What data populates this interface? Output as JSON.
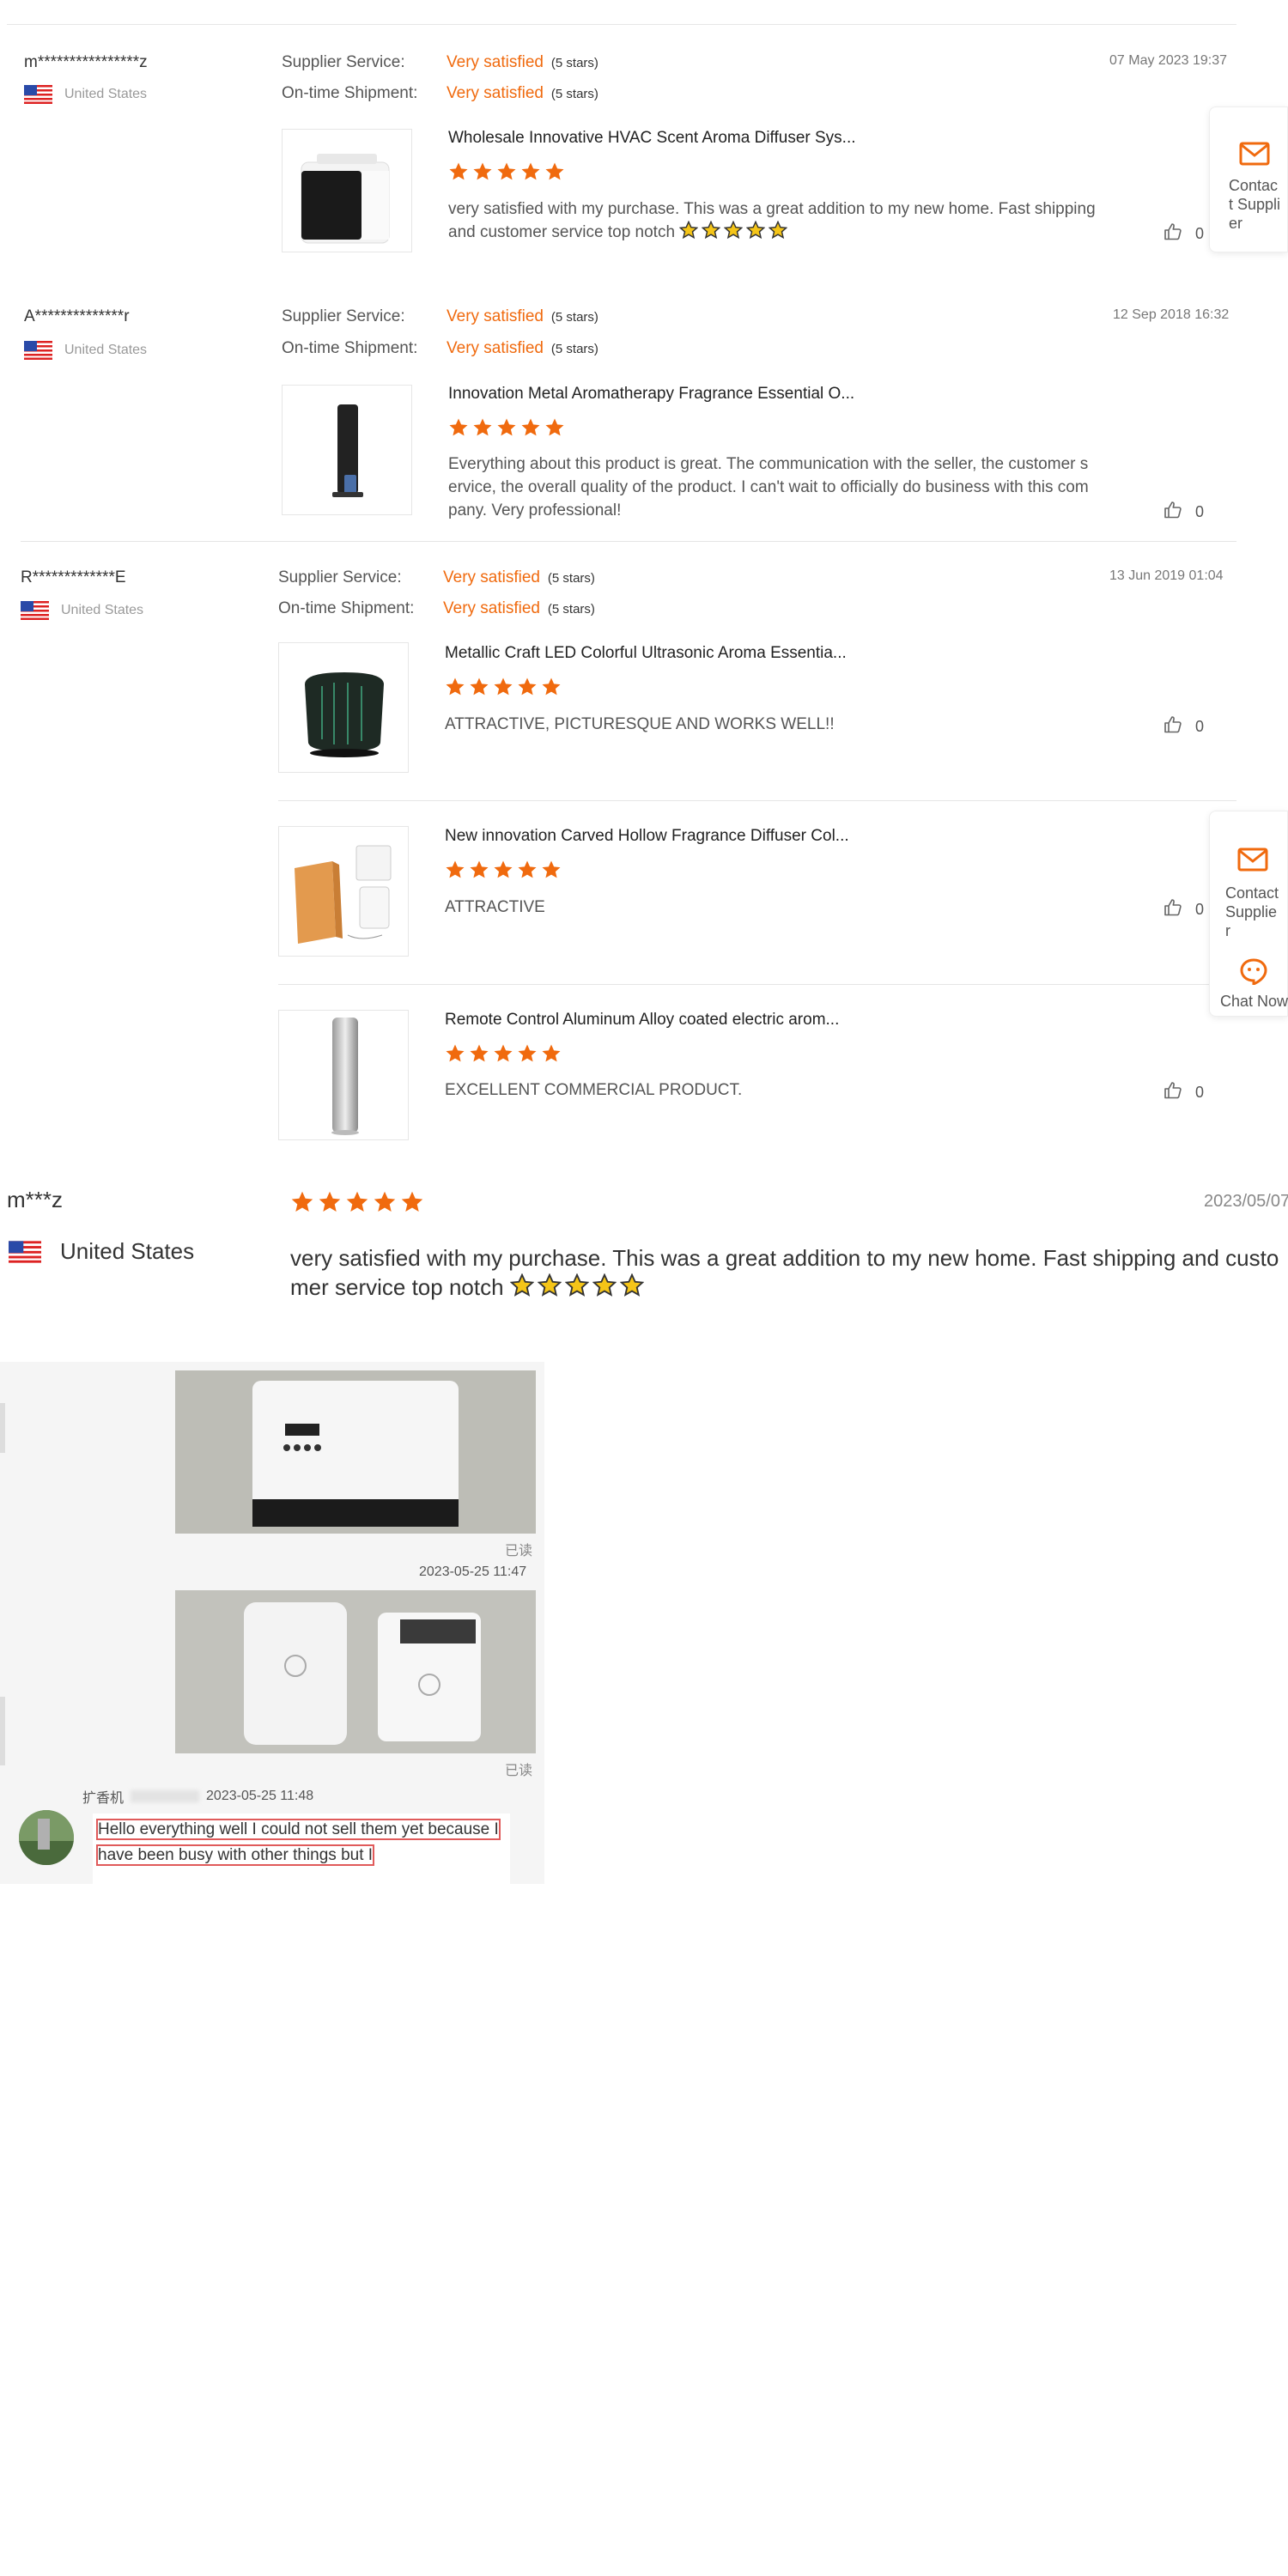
{
  "reviews": [
    {
      "reviewer": "m****************z",
      "country": "United States",
      "supplier_service_label": "Supplier Service:",
      "supplier_service_value": "Very satisfied",
      "supplier_service_stars": "(5 stars)",
      "shipment_label": "On-time Shipment:",
      "shipment_value": "Very satisfied",
      "shipment_stars": "(5 stars)",
      "date": "07 May 2023 19:37",
      "products": [
        {
          "title": "Wholesale Innovative HVAC Scent Aroma Diffuser Sys...",
          "rating": 5,
          "text": "very satisfied with my purchase. This was a great addition to my new home. Fast shipping and customer service top notch",
          "likes": "0"
        }
      ]
    },
    {
      "reviewer": "A**************r",
      "country": "United States",
      "supplier_service_label": "Supplier Service:",
      "supplier_service_value": "Very satisfied",
      "supplier_service_stars": "(5 stars)",
      "shipment_label": "On-time Shipment:",
      "shipment_value": "Very satisfied",
      "shipment_stars": "(5 stars)",
      "date": "12 Sep 2018 16:32",
      "products": [
        {
          "title": "Innovation Metal Aromatherapy Fragrance Essential O...",
          "rating": 5,
          "text": "Everything about this product is great. The communication with the seller, the customer service, the overall quality of the product. I can't wait to officially do business with this company. Very professional!",
          "likes": "0"
        }
      ]
    },
    {
      "reviewer": "R*************E",
      "country": "United States",
      "supplier_service_label": "Supplier Service:",
      "supplier_service_value": "Very satisfied",
      "supplier_service_stars": "(5 stars)",
      "shipment_label": "On-time Shipment:",
      "shipment_value": "Very satisfied",
      "shipment_stars": "(5 stars)",
      "date": "13 Jun 2019 01:04",
      "products": [
        {
          "title": "Metallic Craft LED Colorful Ultrasonic Aroma Essentia...",
          "rating": 5,
          "text": "ATTRACTIVE, PICTURESQUE AND WORKS WELL!!",
          "likes": "0"
        },
        {
          "title": "New innovation Carved Hollow Fragrance Diffuser Col...",
          "rating": 5,
          "text": "ATTRACTIVE",
          "likes": "0"
        },
        {
          "title": "Remote Control Aluminum Alloy coated electric arom...",
          "rating": 5,
          "text": "EXCELLENT COMMERCIAL PRODUCT.",
          "likes": "0"
        }
      ]
    }
  ],
  "side_panel": {
    "contact_label": "Contact Supplier",
    "chat_label": "Chat Now"
  },
  "featured_review": {
    "reviewer": "m***z",
    "country": "United States",
    "rating": 5,
    "date": "2023/05/07",
    "text": "very satisfied with my purchase. This was a great addition to my new home. Fast shipping and customer service top notch"
  },
  "chat": {
    "read_label": "已读",
    "timestamp_1": "2023-05-25 11:47",
    "sender_name": "扩香机",
    "timestamp_2": "2023-05-25 11:48",
    "message": "Hello everything well I could not sell them yet because I have been busy with other things but I"
  },
  "colors": {
    "accent": "#f06a0e",
    "star": "#f06a0e",
    "emoji_star": "#f5c518"
  },
  "icons": [
    "flag-us-icon",
    "star-icon",
    "thumbs-up-icon",
    "mail-icon",
    "chat-icon",
    "avatar"
  ]
}
